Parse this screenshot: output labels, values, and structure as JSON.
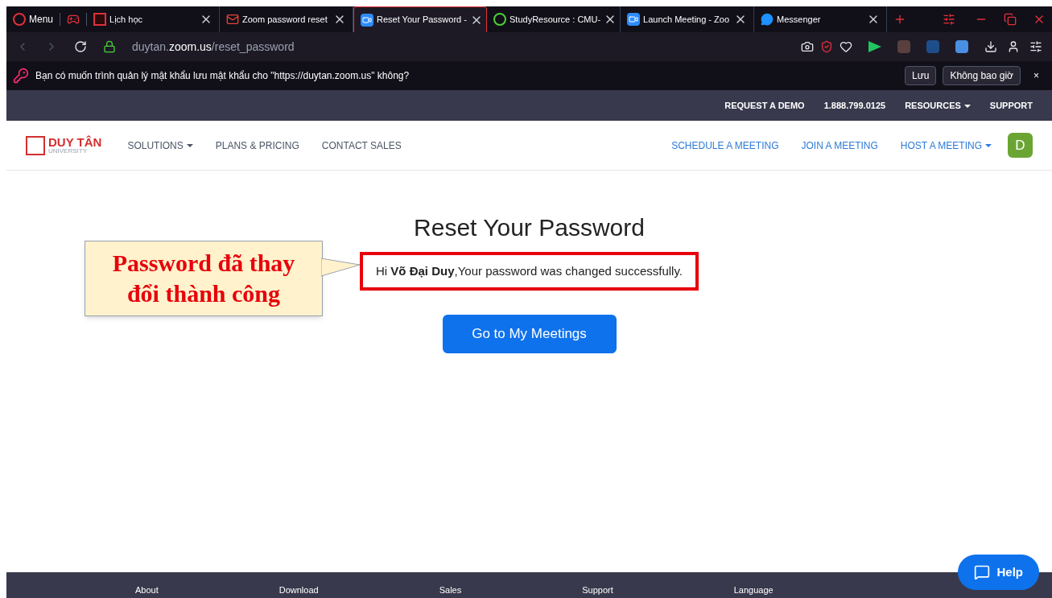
{
  "browser": {
    "menu": "Menu",
    "tabs": [
      {
        "title": "Lịch học",
        "kind": "calendar",
        "selected": false
      },
      {
        "title": "Zoom password reset",
        "kind": "mail",
        "selected": false
      },
      {
        "title": "Reset Your Password -",
        "kind": "video",
        "selected": true
      },
      {
        "title": "StudyResource : CMU-",
        "kind": "study",
        "selected": false
      },
      {
        "title": "Launch Meeting - Zoo",
        "kind": "video",
        "selected": false
      },
      {
        "title": "Messenger",
        "kind": "chat",
        "selected": false
      }
    ],
    "address": {
      "host_prefix": "duytan.",
      "host_main": "zoom.us",
      "path": "/reset_password"
    }
  },
  "password_prompt": {
    "message": "Bạn có muốn trình quản lý mật khẩu lưu mật khẩu cho \"https://duytan.zoom.us\" không?",
    "buttons": [
      "Lưu",
      "Không bao giờ"
    ],
    "close": "×"
  },
  "top_bar": [
    {
      "label": "REQUEST A DEMO",
      "dropdown": false
    },
    {
      "label": "1.888.799.0125",
      "dropdown": false
    },
    {
      "label": "RESOURCES",
      "dropdown": true
    },
    {
      "label": "SUPPORT",
      "dropdown": false
    }
  ],
  "nav": {
    "logo_title": "DUY TÂN",
    "logo_sub": "UNIVERSITY",
    "left": [
      {
        "label": "SOLUTIONS",
        "dropdown": true
      },
      {
        "label": "PLANS & PRICING",
        "dropdown": false
      },
      {
        "label": "CONTACT SALES",
        "dropdown": false
      }
    ],
    "right": [
      {
        "label": "SCHEDULE A MEETING",
        "dropdown": false
      },
      {
        "label": "JOIN A MEETING",
        "dropdown": false
      },
      {
        "label": "HOST A MEETING",
        "dropdown": true
      }
    ],
    "avatar": "D"
  },
  "main": {
    "title": "Reset Your Password",
    "message": "Hi **Võ Đại Duy**,Your password was changed successfully.",
    "button": "Go to My Meetings"
  },
  "callout": "Password đã thay đổi thành công",
  "help": "Help",
  "footer": [
    "About",
    "Download",
    "Sales",
    "Support",
    "Language"
  ]
}
